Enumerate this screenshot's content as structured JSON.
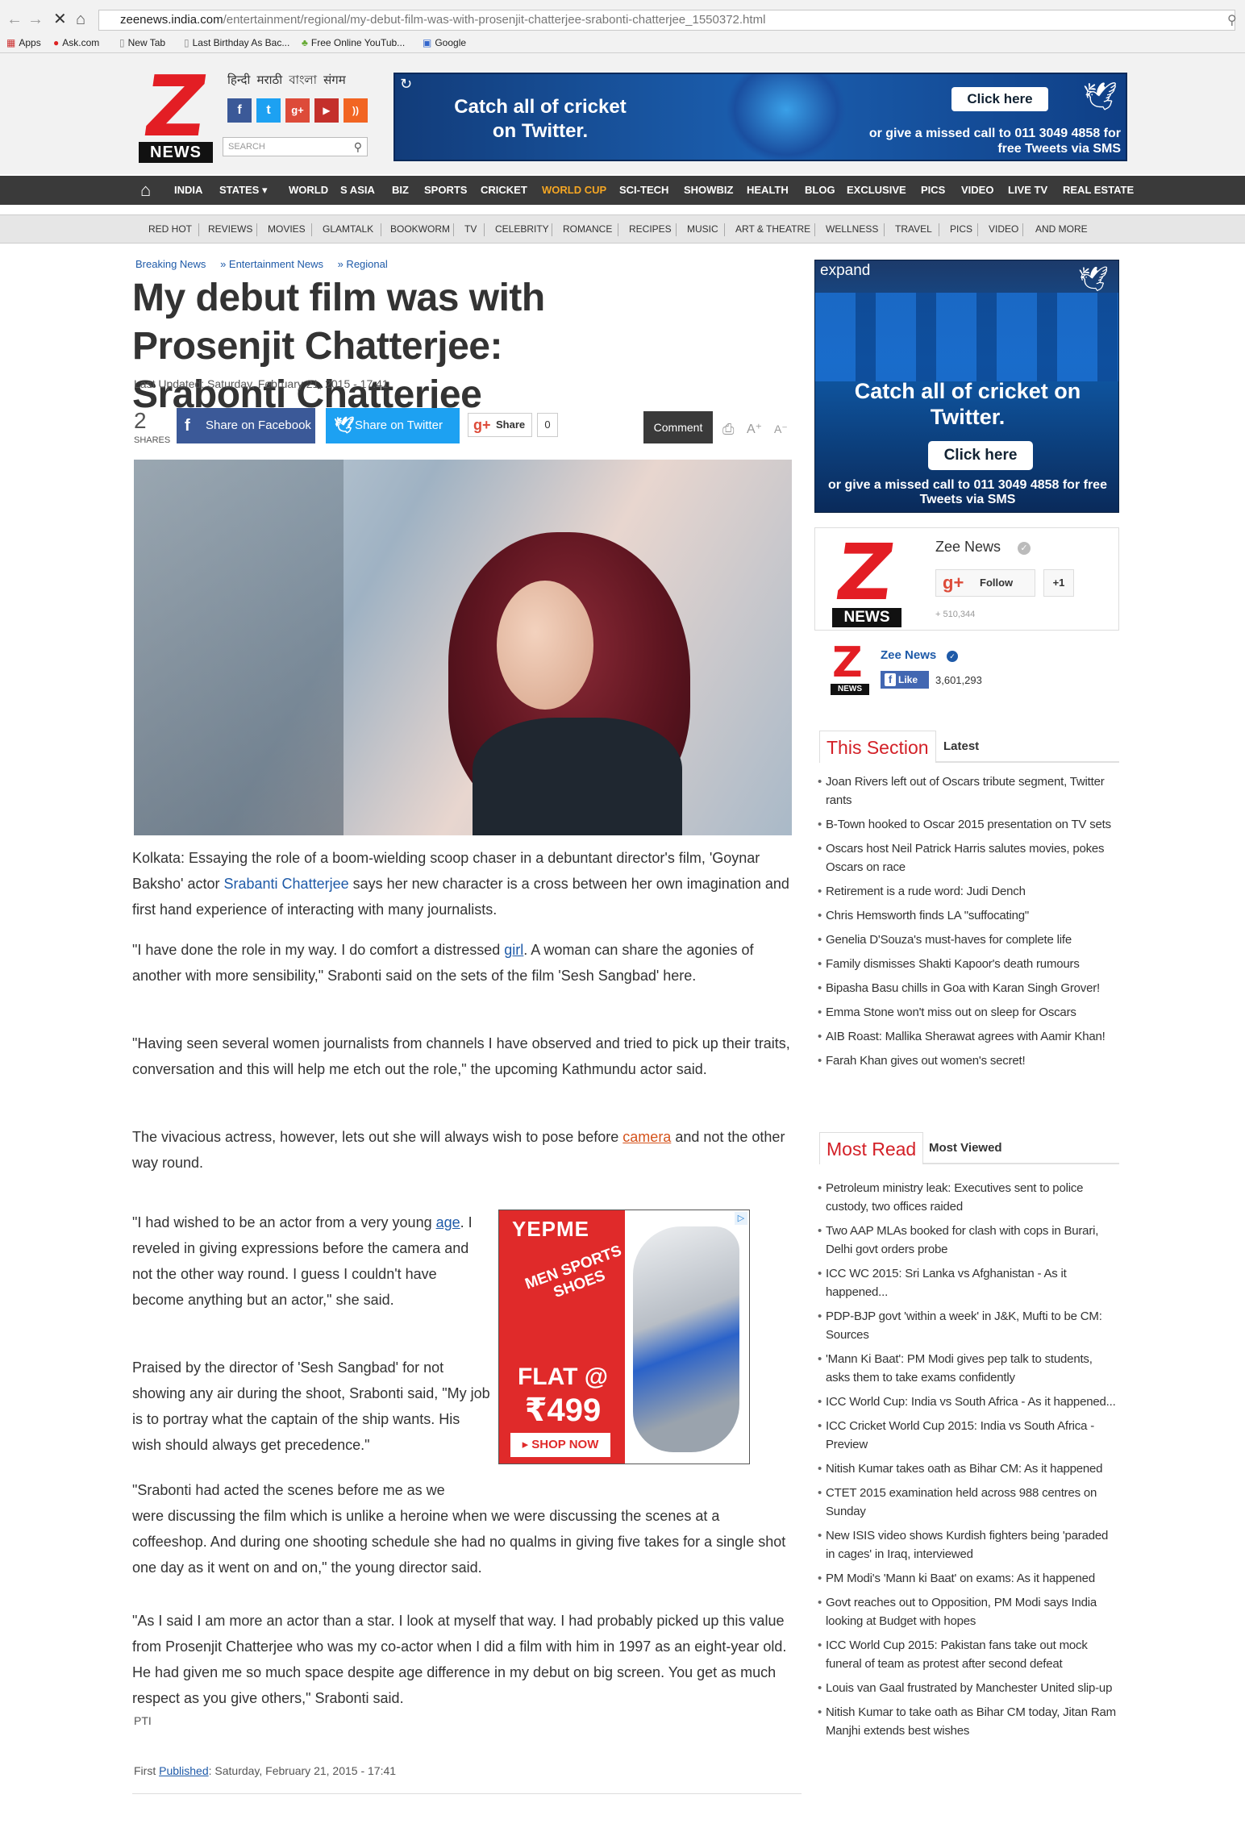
{
  "browser": {
    "url_host": "zeenews.india.com",
    "url_path": "/entertainment/regional/my-debut-film-was-with-prosenjit-chatterjee-srabonti-chatterjee_1550372.html",
    "bookmarks": [
      "Apps",
      "Ask.com",
      "New Tab",
      "Last Birthday As Bac...",
      "Free Online YouTub...",
      "Google"
    ]
  },
  "header": {
    "logo_letter": "Z",
    "logo_text": "NEWS",
    "languages": "हिन्दी  मराठी  বাংলা  संगम",
    "social": [
      "f",
      "t",
      "g+",
      "▶",
      "))"
    ],
    "search_placeholder": "SEARCH"
  },
  "top_ad": {
    "headline": "Catch all of cricket on Twitter.",
    "button": "Click here",
    "sub": "or give a missed call to 011 3049 4858 for free Tweets via SMS"
  },
  "nav_primary": [
    "INDIA",
    "STATES ▾",
    "WORLD",
    "S ASIA",
    "BIZ",
    "SPORTS",
    "CRICKET",
    "WORLD CUP",
    "SCI-TECH",
    "SHOWBIZ",
    "HEALTH",
    "BLOG",
    "EXCLUSIVE",
    "PICS",
    "VIDEO",
    "LIVE TV",
    "REAL ESTATE"
  ],
  "nav_secondary": [
    "RED HOT",
    "REVIEWS",
    "MOVIES",
    "GLAMTALK",
    "BOOKWORM",
    "TV",
    "CELEBRITY",
    "ROMANCE",
    "RECIPES",
    "MUSIC",
    "ART & THEATRE",
    "WELLNESS",
    "TRAVEL",
    "PICS",
    "VIDEO",
    "AND MORE"
  ],
  "accent_color": "#f5a623",
  "article": {
    "breadcrumbs": [
      "Breaking News",
      "» Entertainment News",
      "» Regional"
    ],
    "title": "My debut film was with Prosenjit Chatterjee: Srabonti Chatterjee",
    "last_updated": "Last Updated: Saturday, February 21, 2015 - 17:41",
    "share_count": "2",
    "share_label": "SHARES",
    "fb_share": "Share on Facebook",
    "tw_share": "Share on Twitter",
    "gplus_share": "Share",
    "gplus_count": "0",
    "comment": "Comment",
    "p1a": "Kolkata: Essaying the role of a boom-wielding scoop chaser in a debuntant director's film, 'Goynar Baksho' actor ",
    "p1_link": "Srabanti Chatterjee",
    "p1b": " says her new character is a cross between her own imagination and first hand experience of interacting with many journalists.",
    "p2a": "\"I have done the role in my way. I do comfort a distressed ",
    "p2_link": "girl",
    "p2b": ". A woman can share the agonies of another with more sensibility,\" Srabonti said on the sets of the film 'Sesh Sangbad' here.",
    "p3": "\"Having seen several women journalists from channels I have observed and tried to pick up their traits, conversation and this will help me etch out the role,\" the upcoming Kathmundu actor said.",
    "p4a": "The vivacious actress, however, lets out she will always wish to pose before ",
    "p4_link": "camera",
    "p4b": " and not the other way round.",
    "p5a": "\"I had wished to be an actor from a very young ",
    "p5_link": "age",
    "p5b": ". I reveled in giving expressions before the camera and not the other way round. I guess I couldn't have become anything but an actor,\" she said.",
    "p6": "Praised by the director of 'Sesh Sangbad' for not showing any air during the shoot, Srabonti said, \"My job is to portray what the captain of the ship wants. His wish should always get precedence.\"",
    "p7a": "\"Srabonti had acted the scenes before me as we",
    "p7b": "were discussing the film which is unlike a heroine when we were discussing the scenes at a coffeeshop. And during one shooting schedule she had no qualms in giving five takes for a single shot one day as it went on and on,\" the young director said.",
    "p8": "\"As I said I am more an actor than a star. I look at myself that way. I had probably picked up this value from Prosenjit Chatterjee who was my co-actor when I did a film with him in 1997 as an eight-year old. He had given me so much space despite age difference in my debut on big screen. You get as much respect as you give others,\" Srabonti said.",
    "source": "PTI",
    "first_pub_label": "First ",
    "first_pub_link": "Published",
    "first_pub_date": ": Saturday, February 21, 2015 - 17:41"
  },
  "mid_ad": {
    "brand": "YEPME",
    "tag": "MEN SPORTS SHOES",
    "flat": "FLAT @",
    "price": "₹499",
    "cta": "▸ SHOP NOW"
  },
  "side_ad": {
    "expand": "expand",
    "headline": "Catch all of cricket on Twitter.",
    "button": "Click here",
    "sub": "or give a missed call to 011 3049 4858 for free Tweets via SMS"
  },
  "gplus_widget": {
    "name": "Zee News",
    "follow": "Follow",
    "plus_one": "+1",
    "followers": "+ 510,344"
  },
  "fb_widget": {
    "name": "Zee News",
    "like": "Like",
    "count": "3,601,293"
  },
  "this_section": {
    "tab_active": "This Section",
    "tab_other": "Latest",
    "items": [
      "Joan Rivers left out of Oscars tribute segment, Twitter rants",
      "B-Town hooked to Oscar 2015 presentation on TV sets",
      "Oscars host Neil Patrick Harris salutes movies, pokes Oscars on race",
      "Retirement is a rude word: Judi Dench",
      "Chris Hemsworth finds LA \"suffocating\"",
      "Genelia D'Souza's must-haves for complete life",
      "Family dismisses Shakti Kapoor's death rumours",
      "Bipasha Basu chills in Goa with Karan Singh Grover!",
      "Emma Stone won't miss out on sleep for Oscars",
      "AIB Roast: Mallika Sherawat agrees with Aamir Khan!",
      "Farah Khan gives out women's secret!"
    ]
  },
  "most_read": {
    "tab_active": "Most Read",
    "tab_other": "Most Viewed",
    "items": [
      "Petroleum ministry leak: Executives sent to police custody, two offices raided",
      "Two AAP MLAs booked for clash with cops in Burari, Delhi govt orders probe",
      "ICC WC 2015: Sri Lanka vs Afghanistan - As it happened...",
      "PDP-BJP govt 'within a week' in J&K, Mufti to be CM: Sources",
      "'Mann Ki Baat': PM Modi gives pep talk to students, asks them to take exams confidently",
      "ICC World Cup: India vs South Africa - As it happened...",
      "ICC Cricket World Cup 2015: India vs South Africa - Preview",
      "Nitish Kumar takes oath as Bihar CM: As it happened",
      "CTET 2015 examination held across 988 centres on Sunday",
      "New ISIS video shows Kurdish fighters being 'paraded in cages' in Iraq, interviewed",
      "PM Modi's 'Mann ki Baat' on exams: As it happened",
      "Govt reaches out to Opposition, PM Modi says India looking at Budget with hopes",
      "ICC World Cup 2015: Pakistan fans take out mock funeral of team as protest after second defeat",
      "Louis van Gaal frustrated by Manchester United slip-up",
      "Nitish Kumar to take oath as Bihar CM today, Jitan Ram Manjhi extends best wishes"
    ]
  }
}
